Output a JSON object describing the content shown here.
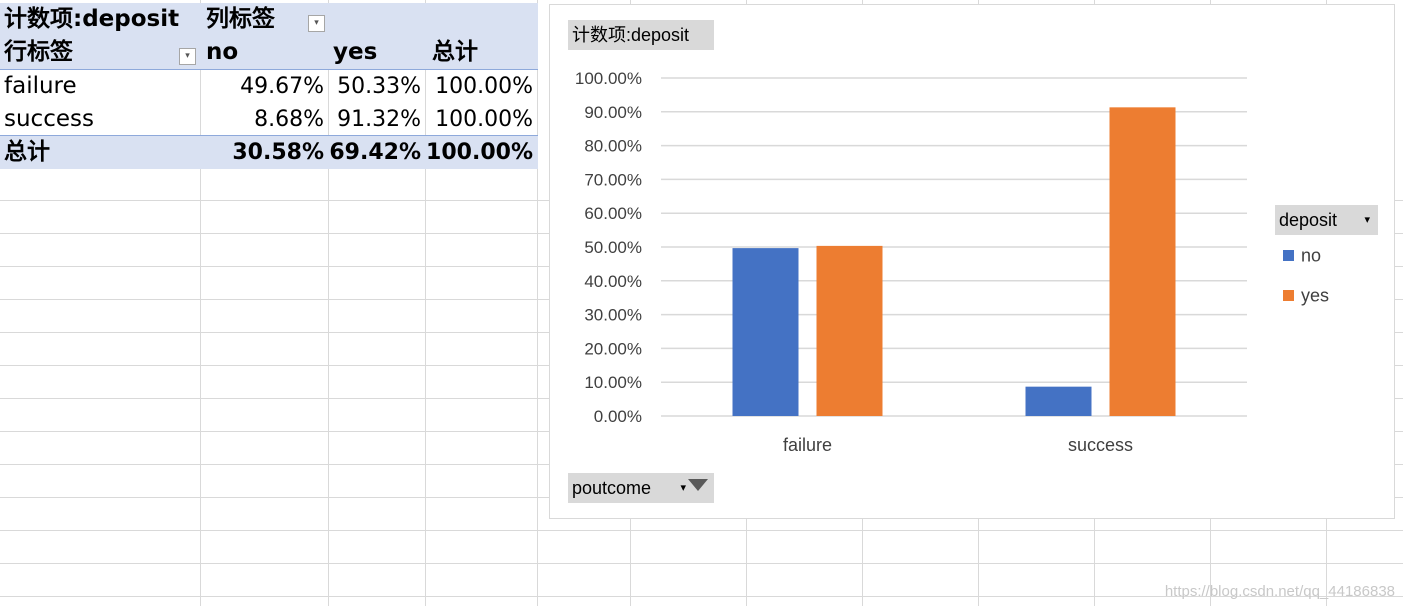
{
  "pivot": {
    "value_field_label": "计数项:deposit",
    "column_labels_header": "列标签",
    "row_labels_header": "行标签",
    "columns": [
      "no",
      "yes",
      "总计"
    ],
    "rows": [
      {
        "label": "failure",
        "values": [
          "49.67%",
          "50.33%",
          "100.00%"
        ]
      },
      {
        "label": "success",
        "values": [
          "8.68%",
          "91.32%",
          "100.00%"
        ]
      }
    ],
    "grand_total": {
      "label": "总计",
      "values": [
        "30.58%",
        "69.42%",
        "100.00%"
      ]
    }
  },
  "chart": {
    "value_field_button": "计数项:deposit",
    "axis_field_button": "poutcome",
    "legend_field_button": "deposit",
    "watermark": "https://blog.csdn.net/qq_44186838"
  },
  "chart_data": {
    "type": "bar",
    "categories": [
      "failure",
      "success"
    ],
    "series": [
      {
        "name": "no",
        "values": [
          49.67,
          8.68
        ],
        "color": "#4472c4"
      },
      {
        "name": "yes",
        "values": [
          50.33,
          91.32
        ],
        "color": "#ed7d31"
      }
    ],
    "ylim": [
      0,
      100
    ],
    "yticks": [
      "0.00%",
      "10.00%",
      "20.00%",
      "30.00%",
      "40.00%",
      "50.00%",
      "60.00%",
      "70.00%",
      "80.00%",
      "90.00%",
      "100.00%"
    ],
    "grid": true,
    "legend_position": "right"
  }
}
